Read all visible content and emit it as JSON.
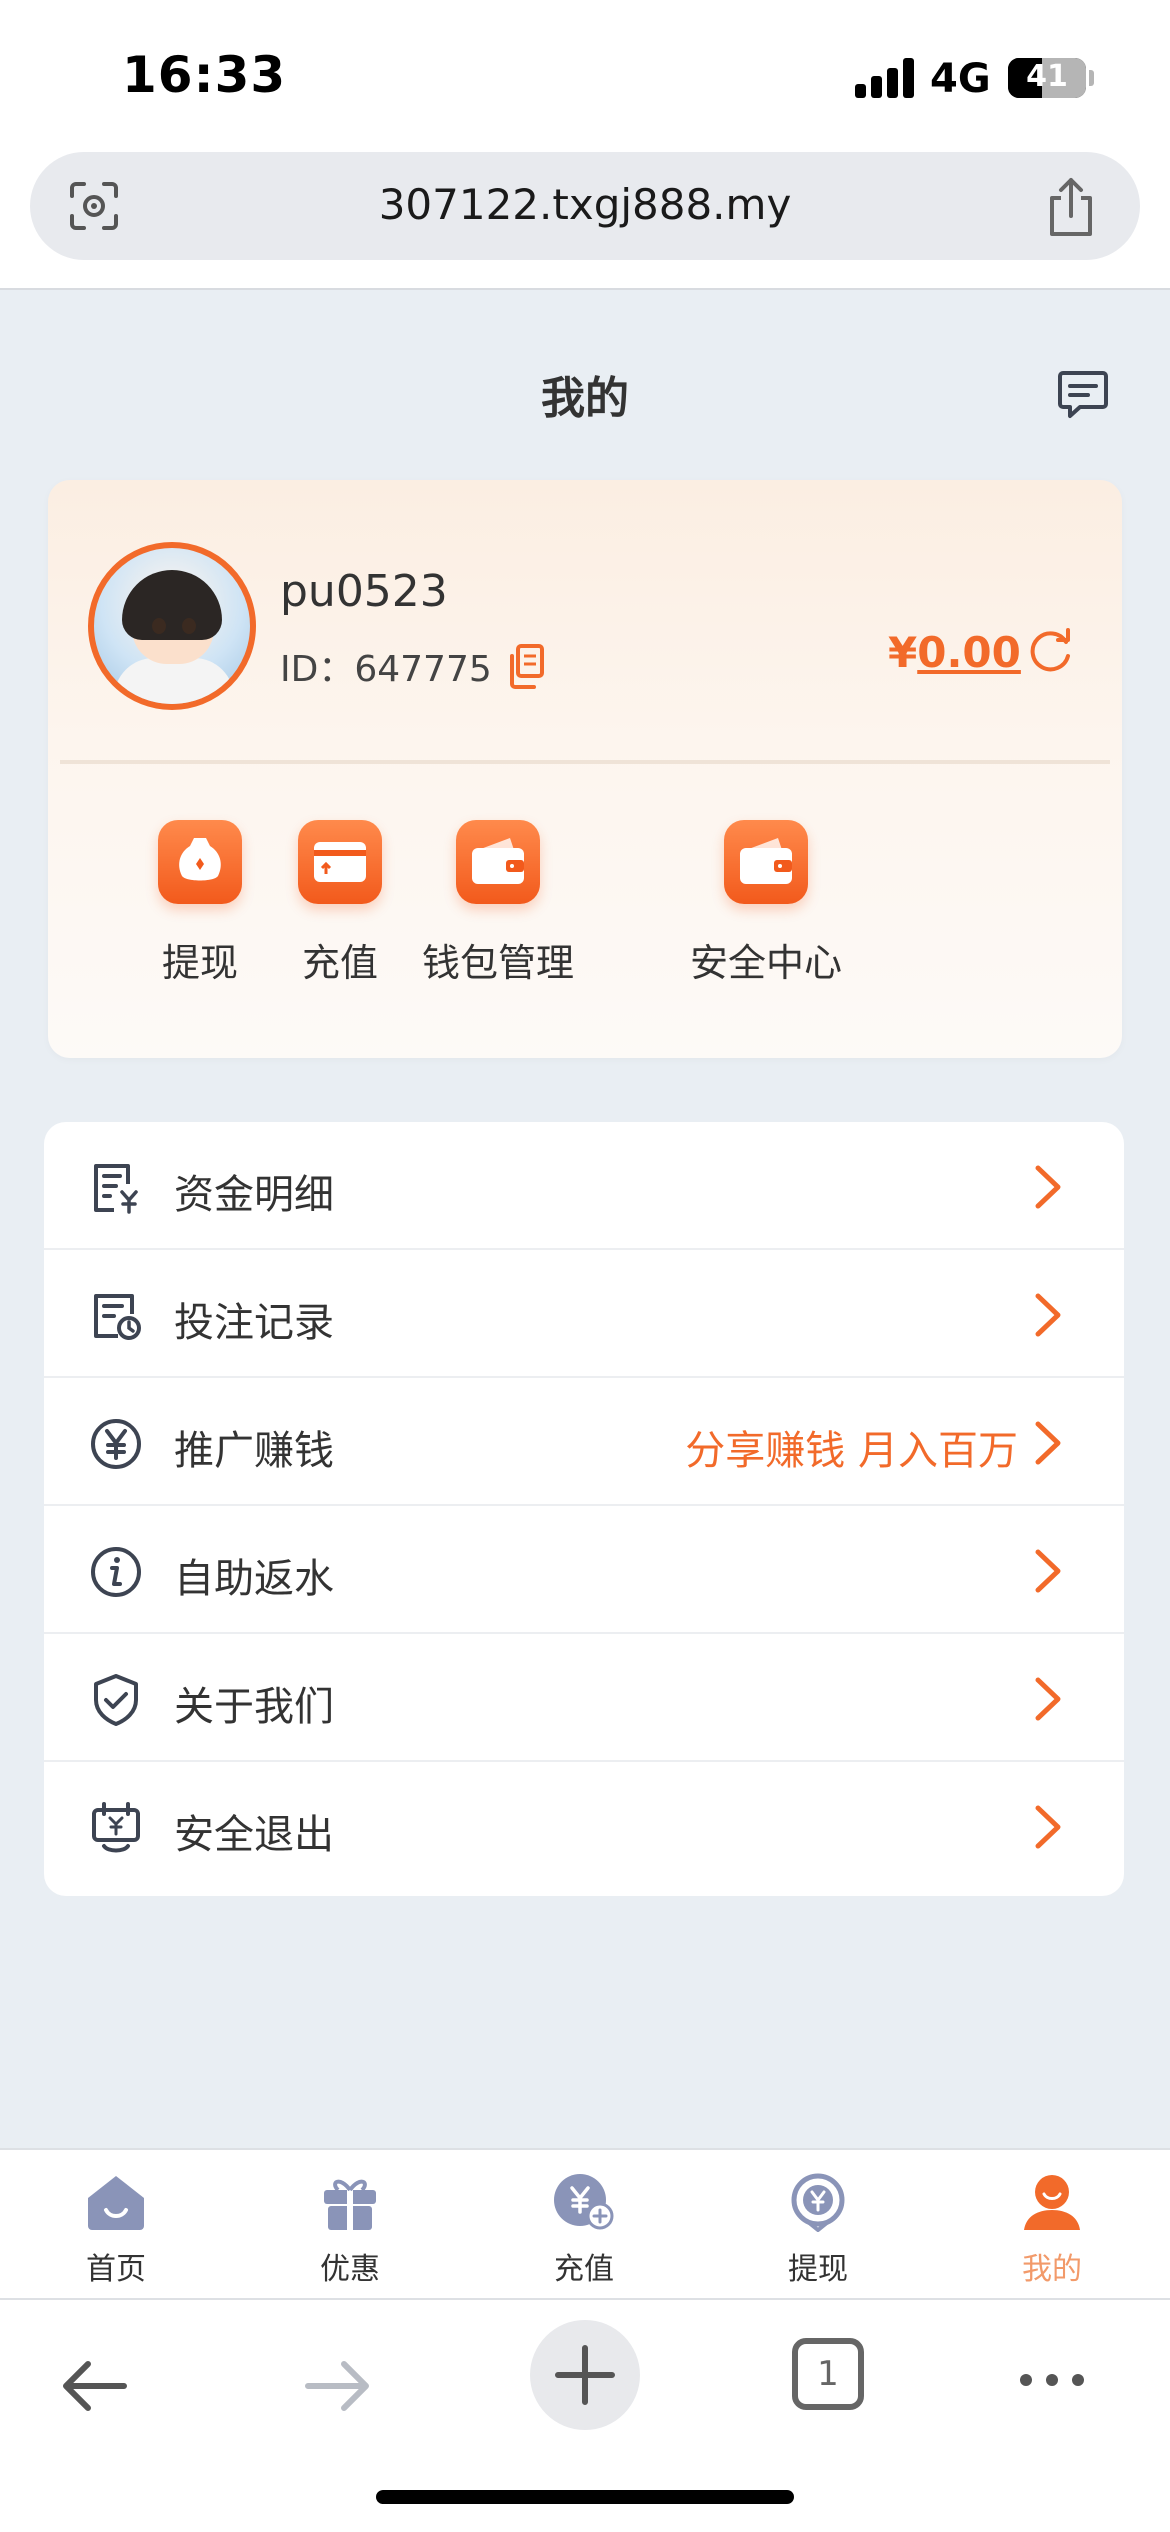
{
  "status": {
    "time": "16:33",
    "network": "4G",
    "battery": "41"
  },
  "browser": {
    "url": "307122.txgj888.my",
    "tab_count": "1"
  },
  "header": {
    "title": "我的"
  },
  "profile": {
    "username": "pu0523",
    "id_label": "ID：",
    "id_value": "647775",
    "currency": "¥",
    "balance": "0.00"
  },
  "quick_actions": [
    {
      "label": "提现",
      "icon": "money-bag-icon"
    },
    {
      "label": "充值",
      "icon": "card-recharge-icon"
    },
    {
      "label": "钱包管理",
      "icon": "wallet-icon"
    },
    {
      "label": "安全中心",
      "icon": "wallet-security-icon"
    }
  ],
  "menu": [
    {
      "label": "资金明细",
      "extra": "",
      "icon": "fund-detail-icon"
    },
    {
      "label": "投注记录",
      "extra": "",
      "icon": "bet-record-icon"
    },
    {
      "label": "推广赚钱",
      "extra": "分享赚钱 月入百万",
      "icon": "yen-circle-icon"
    },
    {
      "label": "自助返水",
      "extra": "",
      "icon": "info-circle-icon"
    },
    {
      "label": "关于我们",
      "extra": "",
      "icon": "shield-check-icon"
    },
    {
      "label": "安全退出",
      "extra": "",
      "icon": "logout-icon"
    }
  ],
  "tabs": [
    {
      "label": "首页",
      "icon": "home-icon",
      "active": false
    },
    {
      "label": "优惠",
      "icon": "gift-icon",
      "active": false
    },
    {
      "label": "充值",
      "icon": "recharge-icon",
      "active": false
    },
    {
      "label": "提现",
      "icon": "withdraw-icon",
      "active": false
    },
    {
      "label": "我的",
      "icon": "profile-icon",
      "active": true
    }
  ],
  "colors": {
    "accent": "#f26a2a",
    "tab_inactive": "#8a94b8",
    "background": "#e9eef3"
  }
}
